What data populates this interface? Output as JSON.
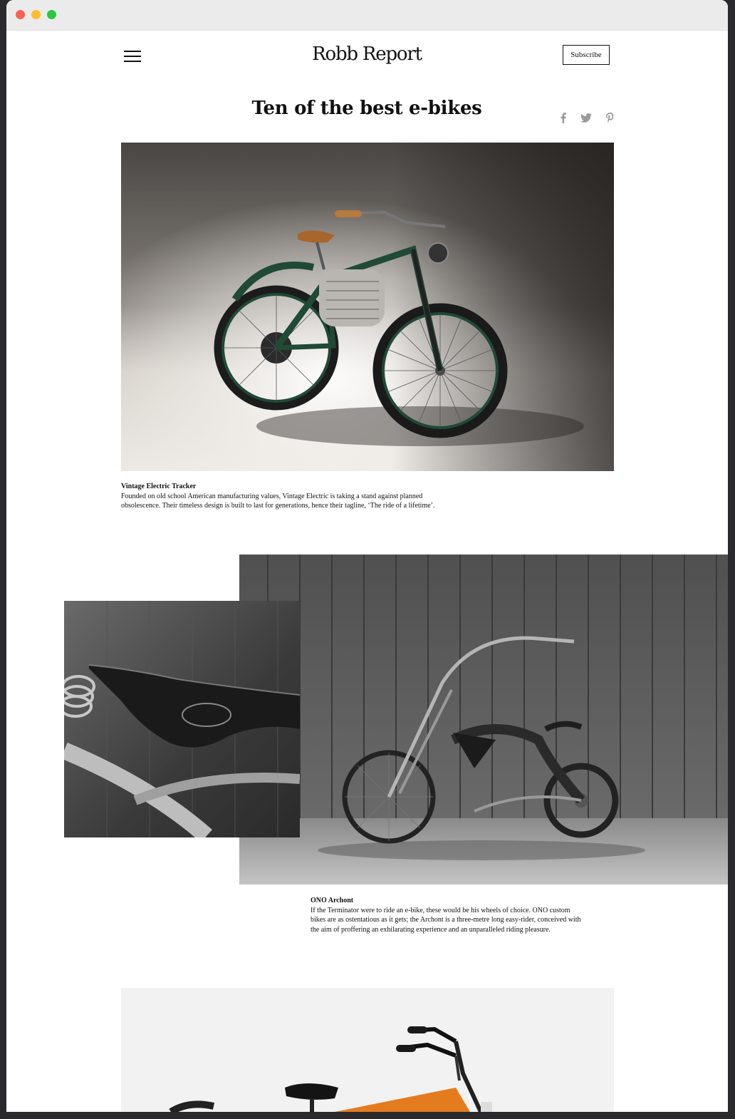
{
  "browser": {
    "traffic_lights": [
      "#fe5f57",
      "#febc2e",
      "#28c840"
    ]
  },
  "header": {
    "logo": "Robb Report",
    "subscribe_label": "Subscribe"
  },
  "article": {
    "title": "Ten of the best e-bikes",
    "share_icons": [
      "facebook-icon",
      "twitter-icon",
      "pinterest-icon"
    ]
  },
  "items": [
    {
      "title": "Vintage Electric Tracker",
      "description": "Founded on old school American manufacturing values, Vintage Electric is taking a stand against planned obsolescence. Their timeless design is built to last for generations, hence their tagline, ‘The ride of a lifetime’."
    },
    {
      "title": "ONO Archont",
      "description": "If the Terminator were to ride an e-bike, these would be his wheels of choice. ONO custom bikes are as ostentatious as it gets; the Archont is a three-metre long easy-rider, conceived with the aim of proffering an exhilarating experience and an unparalleled riding pleasure."
    }
  ]
}
